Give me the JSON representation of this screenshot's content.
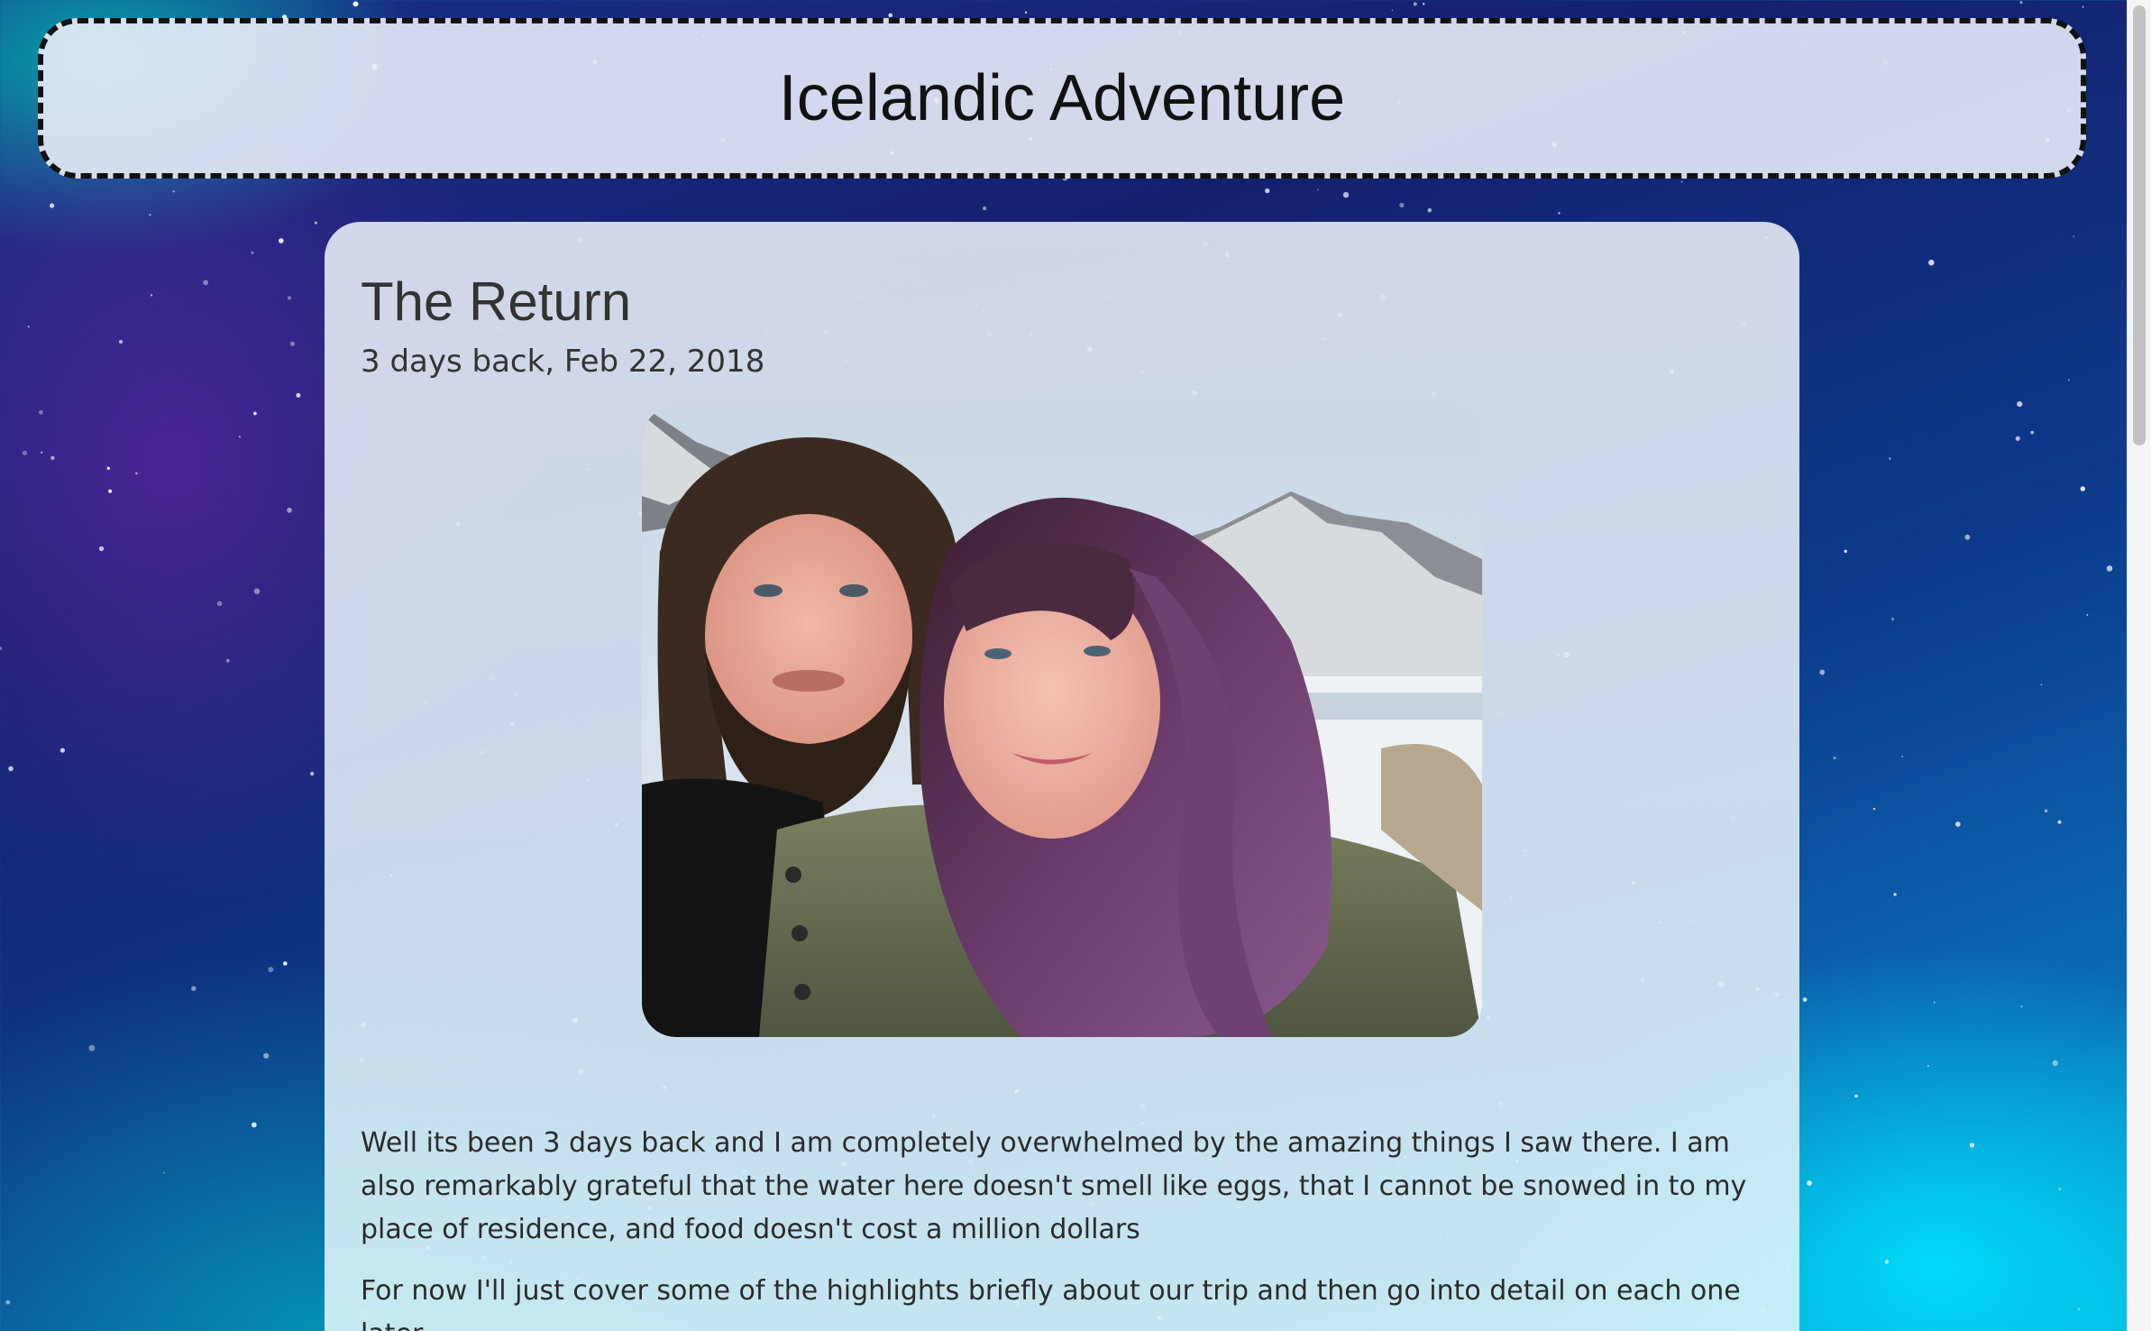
{
  "site": {
    "title": "Icelandic Adventure"
  },
  "post": {
    "title": "The Return",
    "date": "3 days back, Feb 22, 2018",
    "photo_icon": "couple-selfie-photo",
    "paragraphs": [
      "Well its been 3 days back and I am completely overwhelmed by the amazing things I saw there. I am also remarkably grateful that the water here doesn't smell like eggs, that I cannot be snowed in to my place of residence, and food doesn't cost a million dollars",
      "For now I'll just cover some of the highlights briefly about our trip and then go into detail on each one later."
    ]
  },
  "colors": {
    "header_border": "#111111",
    "text": "#333333",
    "background_deep": "#14206e",
    "background_aurora": "#08a8d8"
  }
}
